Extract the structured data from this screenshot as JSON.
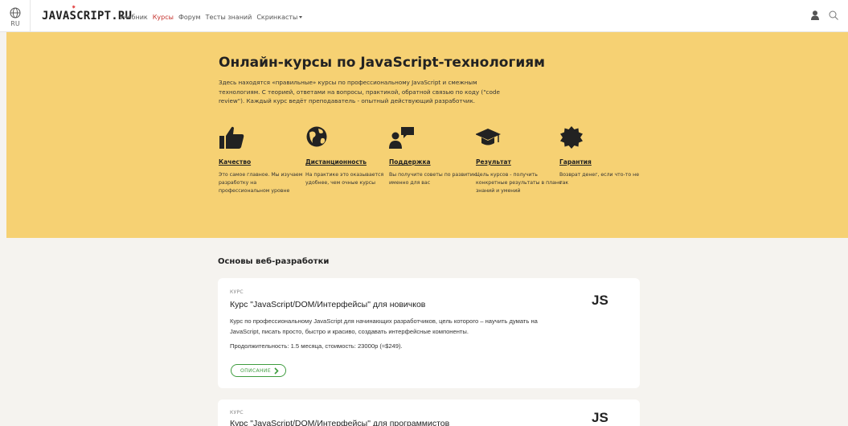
{
  "header": {
    "lang_code": "RU",
    "logo": "JAVASCRIPT.RU",
    "nav": [
      "Учебник",
      "Курсы",
      "Форум",
      "Тесты знаний",
      "Скринкасты"
    ],
    "active_nav": "Курсы"
  },
  "hero": {
    "title": "Онлайн-курсы по JavaScript-технологиям",
    "description": "Здесь находятся «правильные» курсы по профессиональному JavaScript и смежным технологиям. С теорией, ответами на вопросы, практикой, обратной связью по коду (\"code review\"). Каждый курс ведёт преподаватель - опытный действующий разработчик.",
    "features": [
      {
        "icon": "thumbs-up-icon",
        "title": "Качество",
        "text": "Это самое главное. Мы изучаем разработку на профессиональном уровне"
      },
      {
        "icon": "globe-icon",
        "title": "Дистанционность",
        "text": "На практике это оказывается удобнее, чем очные курсы"
      },
      {
        "icon": "support-icon",
        "title": "Поддержка",
        "text": "Вы получите советы по развитию именно для вас"
      },
      {
        "icon": "graduation-cap-icon",
        "title": "Результат",
        "text": "Цель курсов - получить конкретные результаты в плане знаний и умений"
      },
      {
        "icon": "certificate-icon",
        "title": "Гарантия",
        "text": "Возврат денег, если что-то не так"
      }
    ]
  },
  "section": {
    "title": "Основы веб-разработки"
  },
  "courses": [
    {
      "label": "КУРС",
      "title": "Курс \"JavaScript/DOM/Интерфейсы\" для новичков",
      "description": "Курс по профессиональному JavaScript для начинающих разработчиков, цель которого – научить думать на JavaScript, писать просто, быстро и красиво, создавать интерфейсные компоненты.",
      "duration": "Продолжительность: 1.5 месяца, стоимость: 23000р (≈$249).",
      "button": "ОПИСАНИЕ",
      "badge": "JS"
    },
    {
      "label": "КУРС",
      "title": "Курс \"JavaScript/DOM/Интерфейсы\" для программистов",
      "badge": "JS"
    }
  ],
  "colors": {
    "hero_bg": "#f6d173",
    "active_nav": "#c5332e",
    "button": "#3f9c3f"
  }
}
